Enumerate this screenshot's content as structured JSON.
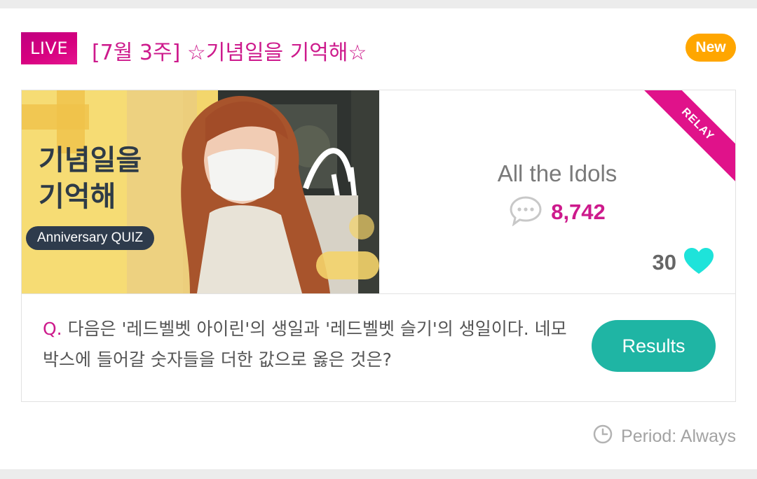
{
  "header": {
    "live_label": "LIVE",
    "title": "[7월 3주] ☆기념일을 기억해☆",
    "new_label": "New"
  },
  "thumbnail": {
    "title": "기념일을\n기억해",
    "subtitle": "Anniversary QUIZ"
  },
  "info": {
    "ribbon_label": "RELAY",
    "source": "All the Idols",
    "comment_count": "8,742",
    "like_count": "30"
  },
  "question": {
    "prefix": "Q.",
    "text": "다음은 '레드벨벳 아이린'의 생일과 '레드벨벳 슬기'의 생일이다. 네모 박스에 들어갈 숫자들을 더한 값으로 옳은 것은?",
    "results_label": "Results"
  },
  "footer": {
    "period": "Period: Always"
  },
  "colors": {
    "accent_pink": "#cd1a8c",
    "new_orange": "#ffa600",
    "results_teal": "#1fb5a4",
    "heart_cyan": "#1ee3da"
  },
  "icons": [
    "comment-bubble-icon",
    "heart-icon",
    "clock-icon"
  ]
}
